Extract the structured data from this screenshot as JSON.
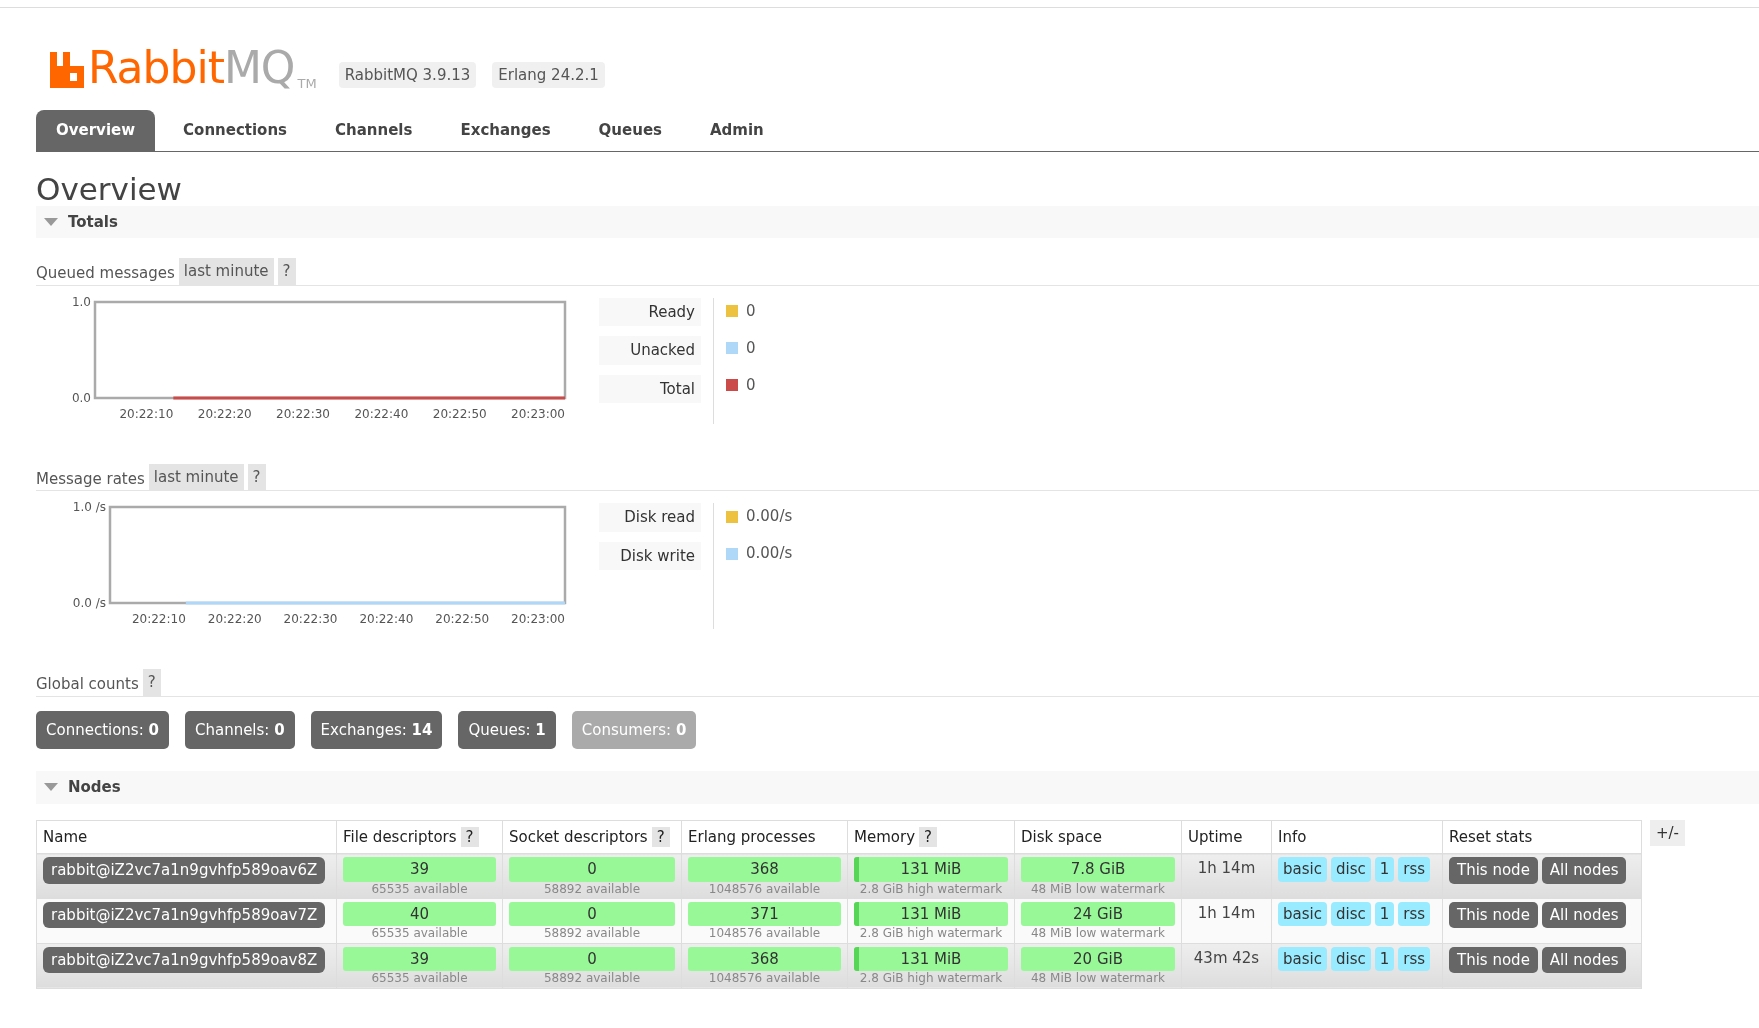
{
  "header": {
    "logo_primary": "Rabbit",
    "logo_secondary": "MQ",
    "trademark": "TM",
    "versions": [
      "RabbitMQ 3.9.13",
      "Erlang 24.2.1"
    ]
  },
  "tabs": [
    {
      "label": "Overview",
      "selected": true
    },
    {
      "label": "Connections",
      "selected": false
    },
    {
      "label": "Channels",
      "selected": false
    },
    {
      "label": "Exchanges",
      "selected": false
    },
    {
      "label": "Queues",
      "selected": false
    },
    {
      "label": "Admin",
      "selected": false
    }
  ],
  "page_title": "Overview",
  "totals": {
    "title": "Totals",
    "expanded": true,
    "queued_messages": {
      "title": "Queued messages",
      "range": "last minute",
      "help": "?",
      "readings": [
        "0",
        "0",
        "0"
      ],
      "chart_data": {
        "type": "line",
        "categories": [
          "20:22:10",
          "20:22:20",
          "20:22:30",
          "20:22:40",
          "20:22:50",
          "20:23:00"
        ],
        "ylim": [
          0,
          1
        ],
        "yticks": [
          {
            "value": 0,
            "label": "0.0"
          },
          {
            "value": 1,
            "label": "1.0"
          }
        ],
        "series": [
          {
            "name": "Ready",
            "color": "#edc240",
            "values": [
              null,
              null,
              null,
              null,
              null,
              null
            ]
          },
          {
            "name": "Unacked",
            "color": "#afd8f8",
            "values": [
              null,
              null,
              null,
              null,
              null,
              null
            ]
          },
          {
            "name": "Total",
            "color": "#cb4b4b",
            "values": [
              0,
              0,
              0,
              0,
              0,
              0
            ]
          }
        ]
      }
    },
    "message_rates": {
      "title": "Message rates",
      "range": "last minute",
      "help": "?",
      "readings": [
        "0.00/s",
        "0.00/s"
      ],
      "chart_data": {
        "type": "line",
        "categories": [
          "20:22:10",
          "20:22:20",
          "20:22:30",
          "20:22:40",
          "20:22:50",
          "20:23:00"
        ],
        "ylim": [
          0,
          1
        ],
        "yticks": [
          {
            "value": 0,
            "label": "0.0 /s"
          },
          {
            "value": 1,
            "label": "1.0 /s"
          }
        ],
        "series": [
          {
            "name": "Disk read",
            "color": "#edc240",
            "values": [
              null,
              null,
              null,
              null,
              null,
              null
            ]
          },
          {
            "name": "Disk write",
            "color": "#afd8f8",
            "values": [
              0,
              0,
              0,
              0,
              0,
              0
            ]
          }
        ]
      }
    },
    "global_counts": {
      "title": "Global counts",
      "help": "?",
      "counts": [
        {
          "label": "Connections:",
          "value": "0",
          "muted": false
        },
        {
          "label": "Channels:",
          "value": "0",
          "muted": false
        },
        {
          "label": "Exchanges:",
          "value": "14",
          "muted": false
        },
        {
          "label": "Queues:",
          "value": "1",
          "muted": false
        },
        {
          "label": "Consumers:",
          "value": "0",
          "muted": true
        }
      ]
    }
  },
  "nodes": {
    "title": "Nodes",
    "expanded": true,
    "toggle": "+/-",
    "columns": [
      {
        "label": "Name"
      },
      {
        "label": "File descriptors",
        "help": "?"
      },
      {
        "label": "Socket descriptors",
        "help": "?"
      },
      {
        "label": "Erlang processes"
      },
      {
        "label": "Memory",
        "help": "?"
      },
      {
        "label": "Disk space"
      },
      {
        "label": "Uptime"
      },
      {
        "label": "Info"
      },
      {
        "label": "Reset stats"
      }
    ],
    "rows": [
      {
        "name": "rabbit@iZ2vc7a1n9gvhfp589oav6Z",
        "file_descriptors": {
          "value": "39",
          "sub": "65535 available"
        },
        "socket_descriptors": {
          "value": "0",
          "sub": "58892 available"
        },
        "erlang_processes": {
          "value": "368",
          "sub": "1048576 available"
        },
        "memory": {
          "value": "131 MiB",
          "sub": "2.8 GiB high watermark",
          "level": 0.03
        },
        "disk_space": {
          "value": "7.8 GiB",
          "sub": "48 MiB low watermark"
        },
        "uptime": "1h 14m",
        "info": [
          "basic",
          "disc",
          "1",
          "rss"
        ],
        "reset": [
          "This node",
          "All nodes"
        ]
      },
      {
        "name": "rabbit@iZ2vc7a1n9gvhfp589oav7Z",
        "file_descriptors": {
          "value": "40",
          "sub": "65535 available"
        },
        "socket_descriptors": {
          "value": "0",
          "sub": "58892 available"
        },
        "erlang_processes": {
          "value": "371",
          "sub": "1048576 available"
        },
        "memory": {
          "value": "131 MiB",
          "sub": "2.8 GiB high watermark",
          "level": 0.03
        },
        "disk_space": {
          "value": "24 GiB",
          "sub": "48 MiB low watermark"
        },
        "uptime": "1h 14m",
        "info": [
          "basic",
          "disc",
          "1",
          "rss"
        ],
        "reset": [
          "This node",
          "All nodes"
        ]
      },
      {
        "name": "rabbit@iZ2vc7a1n9gvhfp589oav8Z",
        "file_descriptors": {
          "value": "39",
          "sub": "65535 available"
        },
        "socket_descriptors": {
          "value": "0",
          "sub": "58892 available"
        },
        "erlang_processes": {
          "value": "368",
          "sub": "1048576 available"
        },
        "memory": {
          "value": "131 MiB",
          "sub": "2.8 GiB high watermark",
          "level": 0.03
        },
        "disk_space": {
          "value": "20 GiB",
          "sub": "48 MiB low watermark"
        },
        "uptime": "43m 42s",
        "info": [
          "basic",
          "disc",
          "1",
          "rss"
        ],
        "reset": [
          "This node",
          "All nodes"
        ]
      }
    ]
  }
}
